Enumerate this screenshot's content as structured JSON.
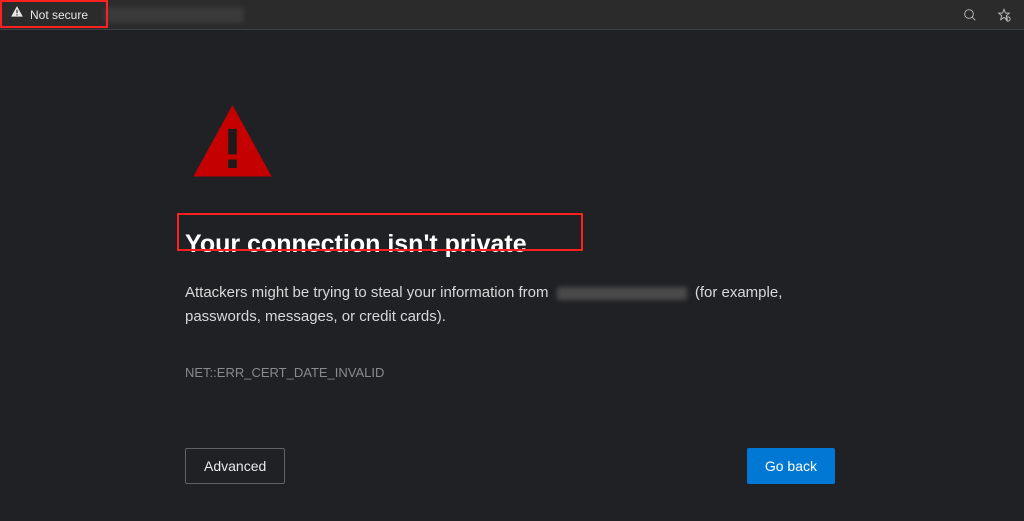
{
  "address_bar": {
    "security_label": "Not secure"
  },
  "page": {
    "title": "Your connection isn't private",
    "desc_prefix": "Attackers might be trying to steal your information from",
    "desc_suffix": "(for example, passwords, messages, or credit cards).",
    "error_code": "NET::ERR_CERT_DATE_INVALID",
    "advanced_label": "Advanced",
    "goback_label": "Go back"
  }
}
